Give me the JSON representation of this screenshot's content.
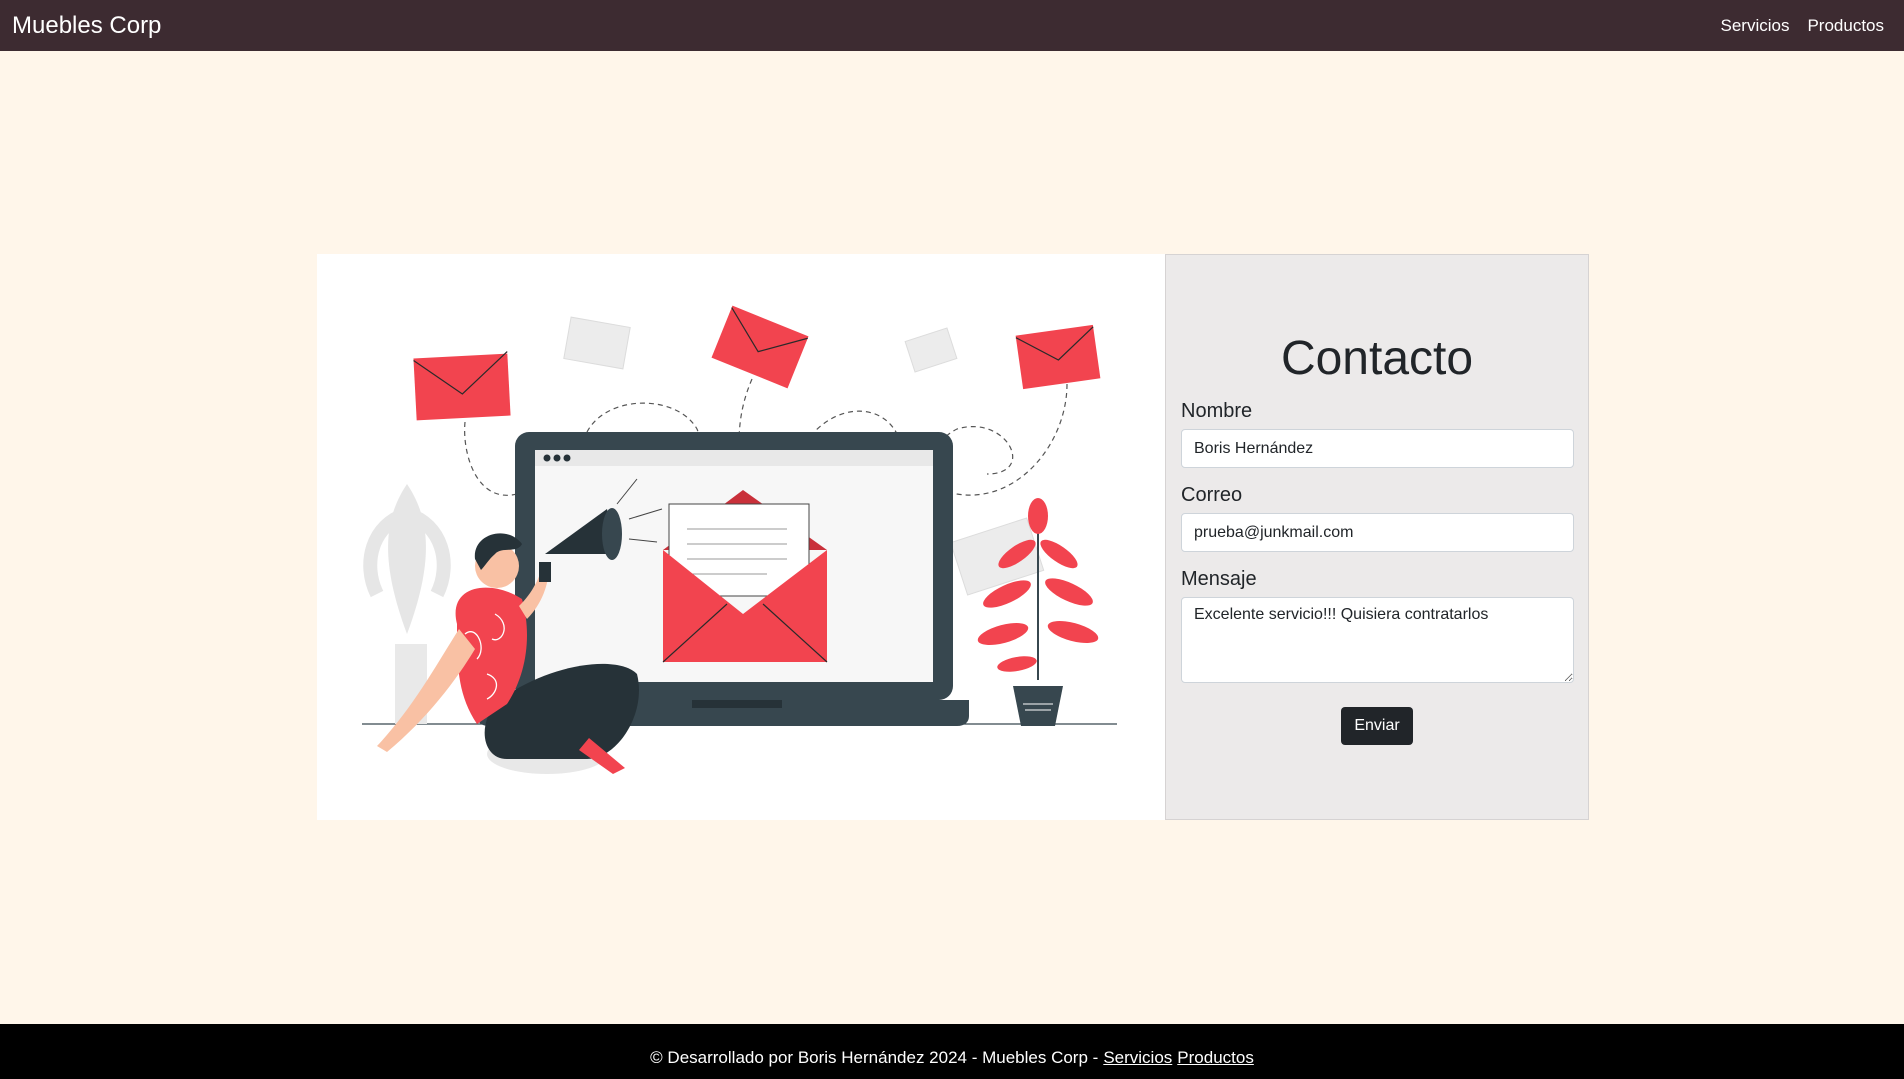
{
  "header": {
    "brand": "Muebles Corp",
    "nav": [
      "Servicios",
      "Productos"
    ]
  },
  "contact": {
    "title": "Contacto",
    "fields": {
      "name_label": "Nombre",
      "name_value": "Boris Hernández",
      "email_label": "Correo",
      "email_value": "prueba@junkmail.com",
      "message_label": "Mensaje",
      "message_value": "Excelente servicio!!! Quisiera contratarlos"
    },
    "submit_label": "Enviar"
  },
  "illustration": {
    "icon": "contact-marketing-illustration",
    "colors": {
      "accent": "#f2444f",
      "dark": "#37474f",
      "light": "#ebebeb"
    }
  },
  "footer": {
    "text": "© Desarrollado por Boris Hernández 2024 - Muebles Corp -",
    "links": [
      "Servicios",
      "Productos"
    ]
  },
  "colors": {
    "page_bg": "#fff6ea",
    "navbar_bg": "#3d2b31",
    "form_bg": "#eceaea",
    "footer_bg": "#000000",
    "button_bg": "#212529"
  }
}
